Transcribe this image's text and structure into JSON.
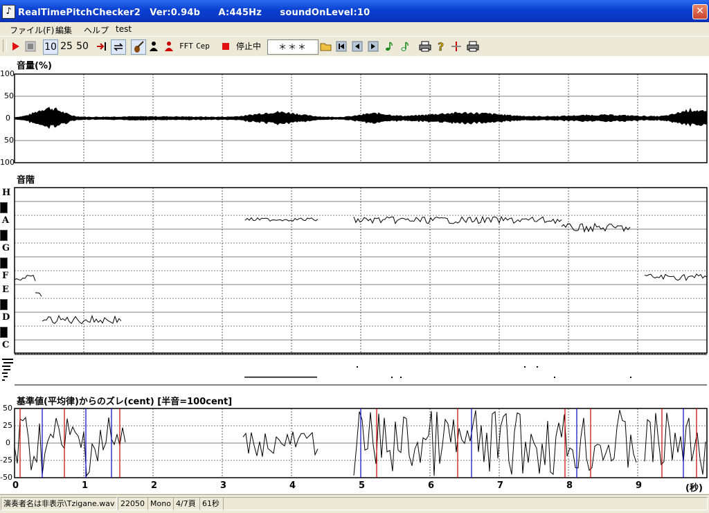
{
  "window": {
    "title": "RealTimePitchChecker2　Ver:0.94b　　A:445Hz　　soundOnLevel:10",
    "close_label": "✕"
  },
  "menu": {
    "items": [
      "ファイル(F)",
      "編集",
      "ヘルプ",
      "test"
    ]
  },
  "toolbar": {
    "window_10": "10",
    "window_25": "25",
    "window_50": "50",
    "fft_label": "FFT",
    "cep_label": "Cep",
    "status_label": "停止中",
    "display_value": "＊＊＊",
    "colors": {
      "play": "#e01010",
      "record": "#e01010",
      "note_green": "#1a8a1a"
    }
  },
  "volume_panel": {
    "title": "音量(%)",
    "y_ticks": [
      "100",
      "50",
      "0",
      "50",
      "100"
    ]
  },
  "pitch_panel": {
    "title": "音階",
    "notes": [
      "H",
      "A",
      "G",
      "F",
      "E",
      "D",
      "C"
    ]
  },
  "cent_panel": {
    "title": "基準値(平均律)からのズレ(cent) [半音=100cent]",
    "y_ticks": [
      "50",
      "25",
      "0",
      "-25",
      "-50"
    ],
    "colors": {
      "red": "#cc0000",
      "blue": "#0000cc"
    }
  },
  "time_axis": {
    "ticks": [
      "0",
      "1",
      "2",
      "3",
      "4",
      "5",
      "6",
      "7",
      "8",
      "9"
    ],
    "unit": "(秒)"
  },
  "statusbar": {
    "file": "演奏者名は非表示\\Tzigane.wav",
    "rate": "22050",
    "channels": "Mono",
    "page": "4/7頁",
    "duration": "61秒"
  }
}
